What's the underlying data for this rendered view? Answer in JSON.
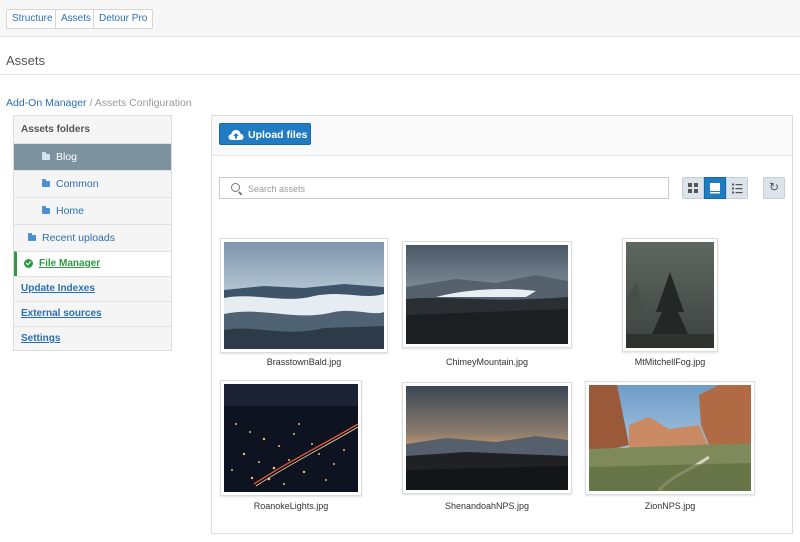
{
  "top_nav": [
    "Structure",
    "Assets",
    "Detour Pro"
  ],
  "page": {
    "title": "Assets"
  },
  "breadcrumb": {
    "link": "Add-On Manager",
    "separator": " / ",
    "current": "Assets Configuration"
  },
  "sidebar": {
    "heading": "Assets folders",
    "folders": [
      "Blog",
      "Common",
      "Home"
    ],
    "active_folder": "Blog",
    "recent": "Recent uploads",
    "links": [
      "File Manager",
      "Update Indexes",
      "External sources",
      "Settings"
    ],
    "current_link": "File Manager"
  },
  "toolbar": {
    "upload_label": "Upload files"
  },
  "search": {
    "placeholder": "Search assets",
    "value": ""
  },
  "view_modes": {
    "options": [
      "grid-icon",
      "thumbnail-icon",
      "list-icon"
    ],
    "selected": "thumbnail-icon"
  },
  "assets": [
    "BrasstownBald.jpg",
    "ChimeyMountain.jpg",
    "MtMitchellFog.jpg",
    "RoanokeLights.jpg",
    "ShenandoahNPS.jpg",
    "ZionNPS.jpg"
  ],
  "colors": {
    "accent": "#1f7bc2",
    "active_folder_bg": "#7d929f",
    "current_link": "#2e9b43",
    "link": "#2b6fb3"
  }
}
